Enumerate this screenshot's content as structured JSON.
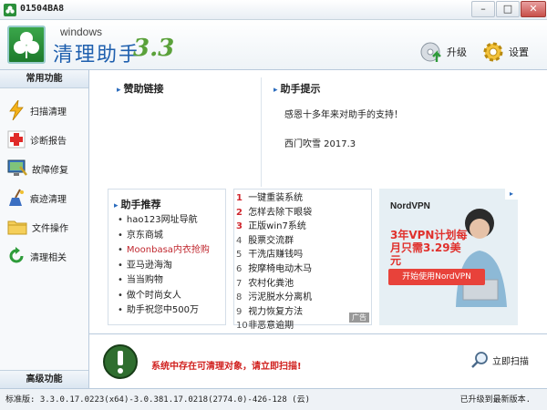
{
  "window": {
    "title": "01504BA8",
    "min_label": "–",
    "max_label": "□",
    "close_label": "✕"
  },
  "header": {
    "brand_en": "windows",
    "brand_cn": "清理助手",
    "brand_version": "3.3",
    "upgrade_label": "升级",
    "settings_label": "设置"
  },
  "sidebar": {
    "title": "常用功能",
    "footer": "高级功能",
    "items": [
      {
        "label": "扫描清理",
        "icon": "lightning-icon"
      },
      {
        "label": "诊断报告",
        "icon": "red-cross-icon"
      },
      {
        "label": "故障修复",
        "icon": "monitor-repair-icon"
      },
      {
        "label": "痕迹清理",
        "icon": "broom-icon"
      },
      {
        "label": "文件操作",
        "icon": "folder-icon"
      },
      {
        "label": "清理相关",
        "icon": "refresh-icon"
      }
    ]
  },
  "main": {
    "sponsor_title": "赞助链接",
    "tips_title": "助手提示",
    "tips_message": "感恩十多年来对助手的支持！",
    "tips_signature": "西门吹雪  2017.3",
    "recommend_title": "助手推荐",
    "recommend_items": [
      {
        "label": "hao123网址导航",
        "highlight": false
      },
      {
        "label": "京东商城",
        "highlight": false
      },
      {
        "label": "Moonbasa内衣抢购",
        "highlight": true
      },
      {
        "label": "亚马逊海淘",
        "highlight": false
      },
      {
        "label": "当当购物",
        "highlight": false
      },
      {
        "label": "做个时尚女人",
        "highlight": false
      },
      {
        "label": "助手祝您中500万",
        "highlight": false
      }
    ],
    "rank_items": [
      {
        "num": "1",
        "label": "一键重装系统"
      },
      {
        "num": "2",
        "label": "怎样去除下眼袋"
      },
      {
        "num": "3",
        "label": "正版win7系统"
      },
      {
        "num": "4",
        "label": "股票交流群"
      },
      {
        "num": "5",
        "label": "干洗店赚钱吗"
      },
      {
        "num": "6",
        "label": "按摩椅电动木马"
      },
      {
        "num": "7",
        "label": "农村化粪池"
      },
      {
        "num": "8",
        "label": "污泥脱水分离机"
      },
      {
        "num": "9",
        "label": "视力恢复方法"
      },
      {
        "num": "10",
        "label": "非恶意逾期"
      }
    ],
    "rank_ad_tag": "广告",
    "ad": {
      "logo": "NordVPN",
      "headline": "3年VPN计划每月只需3.29美元",
      "cta": "开始使用NordVPN"
    }
  },
  "status": {
    "message": "系统中存在可清理对象，请立即扫描!",
    "scan_label": "立即扫描"
  },
  "statusbar": {
    "version": "标准版: 3.3.0.17.0223(x64)-3.0.381.17.0218(2774.0)-426-128 (云)",
    "update": "已升级到最新版本."
  },
  "colors": {
    "accent_blue": "#1e5fae",
    "alert_red": "#d0201e",
    "brand_green": "#2a8f3a"
  }
}
